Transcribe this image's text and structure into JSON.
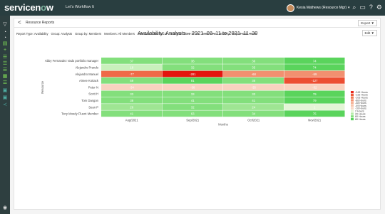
{
  "topbar": {
    "logo_main": "servicenow",
    "tagline": "Let's Workflow It",
    "username": "Kesia Mathews (Resource Mgr)",
    "icons": [
      "search-icon",
      "chat-icon",
      "help-icon",
      "settings-icon"
    ]
  },
  "leftnav": {
    "icons": [
      "filter-icon",
      "history-icon",
      "star-icon",
      "document-icon",
      "plus-icon",
      "list-icon",
      "list-icon",
      "list-icon",
      "calendar-icon",
      "list-icon",
      "grid-icon",
      "share-icon",
      "info-icon"
    ]
  },
  "header": {
    "back": "<",
    "breadcrumb": "Resource Reports",
    "export_label": "Export ▼",
    "edit_label": "Edit ▼"
  },
  "filters": {
    "items": [
      "Report Type: Availability",
      "Group: Analysts",
      "Group by: Members",
      "Members: All Members",
      "Start date: 2022-08-11",
      "End date: 2022-11-30",
      "Zoom Level: Monthly",
      "Report Unit: Hours"
    ]
  },
  "chart_data": {
    "type": "heatmap",
    "title": "Availability: Analysts – 2021–08–11 to 2021–11–30",
    "xlabel": "Months",
    "ylabel": "Resource",
    "x": [
      "Aug/2021",
      "Sep/2021",
      "Oct/2021",
      "Nov/2021"
    ],
    "y": [
      "Abby Fernandez Vado portfolio manager",
      "Alejandro Prando",
      "Alejandro Manuel",
      "Aimee Kottack",
      "Peter N",
      "Scott H",
      "Tom Dangon",
      "Sean P",
      "Tony Moody Fluent Member"
    ],
    "values": [
      [
        37,
        36,
        36,
        74
      ],
      [
        18,
        32,
        35,
        74
      ],
      [
        -77,
        -281,
        -68,
        -59
      ],
      [
        59,
        81,
        36,
        -127
      ],
      [
        -34,
        -38,
        -35,
        -32
      ],
      [
        33,
        33,
        33,
        79
      ],
      [
        38,
        41,
        41,
        79
      ],
      [
        26,
        32,
        24,
        2
      ],
      [
        41,
        63,
        34,
        75
      ]
    ],
    "legend": {
      "position": "right",
      "entries": [
        {
          "label": "-243 Hours",
          "color": "#e8261b"
        },
        {
          "label": "-133 Hours",
          "color": "#ee5a3a"
        },
        {
          "label": "-103 Hours",
          "color": "#f07a55"
        },
        {
          "label": "-88 Hours",
          "color": "#f39272"
        },
        {
          "label": "-48 Hours",
          "color": "#f6b093"
        },
        {
          "label": "-49 Hours",
          "color": "#f8c6ae"
        },
        {
          "label": "-18 Hours",
          "color": "#fad8c6"
        },
        {
          "label": "2 Hours",
          "color": "#e4f5d6"
        },
        {
          "label": "20 Hours",
          "color": "#b6ecaa"
        },
        {
          "label": "60 Hours",
          "color": "#83df7c"
        },
        {
          "label": "80 Hours",
          "color": "#55d25a"
        }
      ]
    }
  }
}
